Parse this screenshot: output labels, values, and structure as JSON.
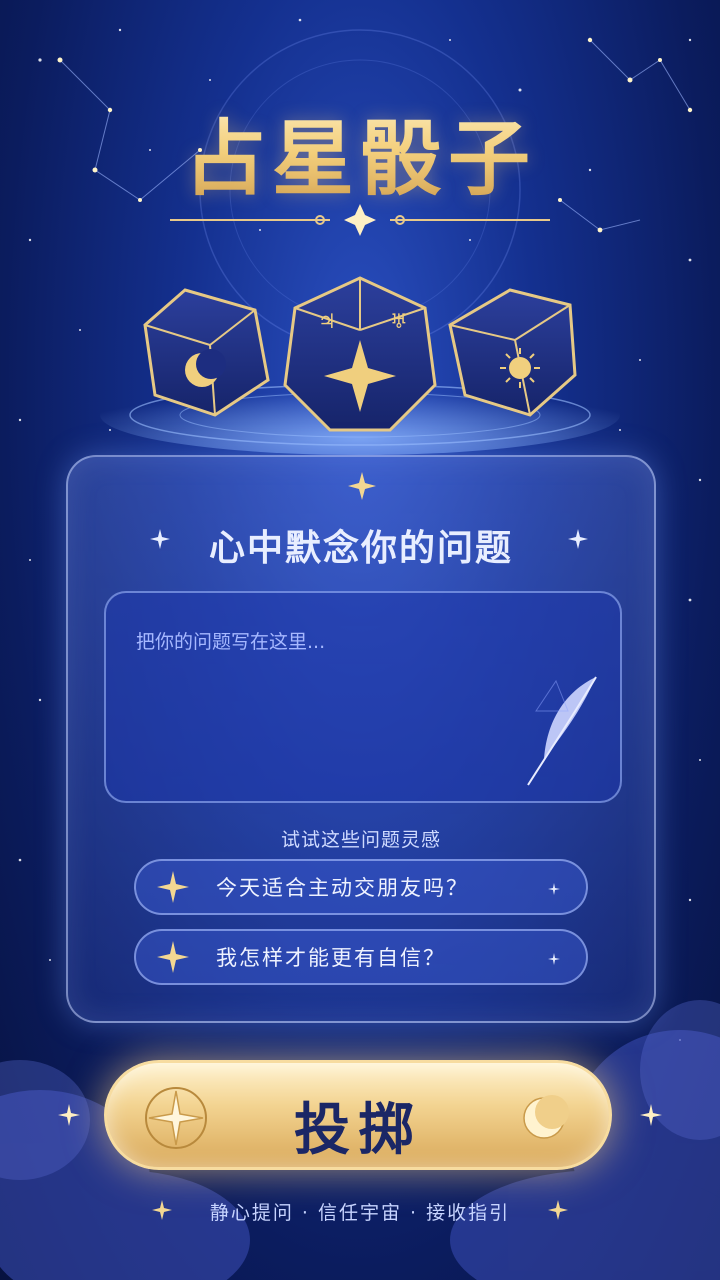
{
  "app": {
    "title": "占星骰子"
  },
  "colors": {
    "gold": "#f0cf7e",
    "navy": "#14308f",
    "panel_border": "#c8d7ff"
  },
  "dice": [
    {
      "symbol": "moon-icon"
    },
    {
      "symbol": "compass-star-icon"
    },
    {
      "symbol": "sun-icon"
    }
  ],
  "panel": {
    "heading": "心中默念你的问题",
    "question": {
      "value": "",
      "placeholder": "把你的问题写在这里..."
    },
    "inspiration_label": "试试这些问题灵感",
    "suggestions": [
      {
        "text": "今天适合主动交朋友吗？"
      },
      {
        "text": "我怎样才能更有自信？"
      }
    ]
  },
  "roll_button": {
    "label": "投掷"
  },
  "footer": {
    "motto": "静心提问 · 信任宇宙 · 接收指引"
  }
}
